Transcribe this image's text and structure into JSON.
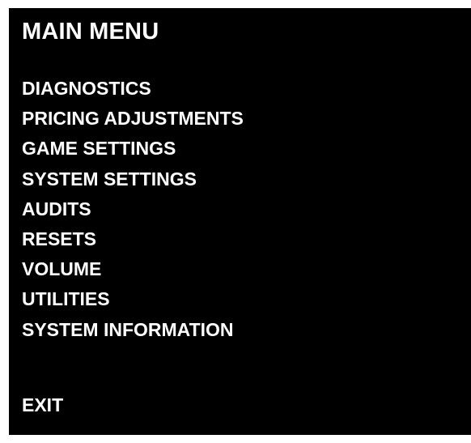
{
  "menu": {
    "title": "MAIN MENU",
    "items": [
      {
        "label": "DIAGNOSTICS"
      },
      {
        "label": "PRICING ADJUSTMENTS"
      },
      {
        "label": "GAME SETTINGS"
      },
      {
        "label": "SYSTEM SETTINGS"
      },
      {
        "label": "AUDITS"
      },
      {
        "label": "RESETS"
      },
      {
        "label": "VOLUME"
      },
      {
        "label": "UTILITIES"
      },
      {
        "label": "SYSTEM INFORMATION"
      }
    ],
    "exit_label": "EXIT"
  },
  "colors": {
    "background": "#000000",
    "text": "#ffffff"
  }
}
